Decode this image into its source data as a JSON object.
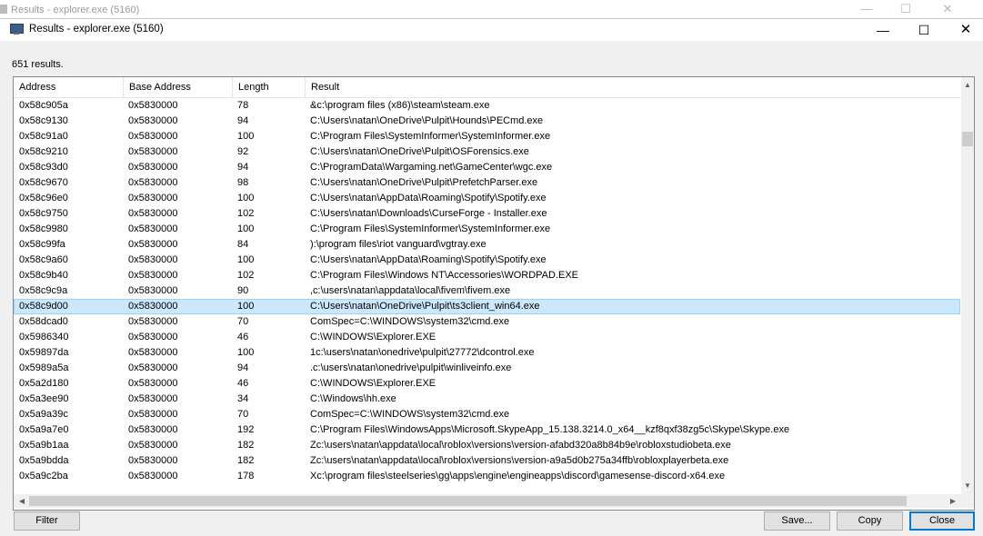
{
  "ghost_window": {
    "title": "Results - explorer.exe (5160)"
  },
  "window": {
    "title": "Results - explorer.exe (5160)",
    "controls": {
      "minimize": "—",
      "maximize": "☐",
      "close": "✕"
    }
  },
  "results_count": "651 results.",
  "columns": [
    "Address",
    "Base Address",
    "Length",
    "Result"
  ],
  "selected_index": 13,
  "rows": [
    [
      "0x58c905a",
      "0x5830000",
      "78",
      "&c:\\program files (x86)\\steam\\steam.exe"
    ],
    [
      "0x58c9130",
      "0x5830000",
      "94",
      "C:\\Users\\natan\\OneDrive\\Pulpit\\Hounds\\PECmd.exe"
    ],
    [
      "0x58c91a0",
      "0x5830000",
      "100",
      "C:\\Program Files\\SystemInformer\\SystemInformer.exe"
    ],
    [
      "0x58c9210",
      "0x5830000",
      "92",
      "C:\\Users\\natan\\OneDrive\\Pulpit\\OSForensics.exe"
    ],
    [
      "0x58c93d0",
      "0x5830000",
      "94",
      "C:\\ProgramData\\Wargaming.net\\GameCenter\\wgc.exe"
    ],
    [
      "0x58c9670",
      "0x5830000",
      "98",
      "C:\\Users\\natan\\OneDrive\\Pulpit\\PrefetchParser.exe"
    ],
    [
      "0x58c96e0",
      "0x5830000",
      "100",
      "C:\\Users\\natan\\AppData\\Roaming\\Spotify\\Spotify.exe"
    ],
    [
      "0x58c9750",
      "0x5830000",
      "102",
      "C:\\Users\\natan\\Downloads\\CurseForge - Installer.exe"
    ],
    [
      "0x58c9980",
      "0x5830000",
      "100",
      "C:\\Program Files\\SystemInformer\\SystemInformer.exe"
    ],
    [
      "0x58c99fa",
      "0x5830000",
      "84",
      "):\\program files\\riot vanguard\\vgtray.exe"
    ],
    [
      "0x58c9a60",
      "0x5830000",
      "100",
      "C:\\Users\\natan\\AppData\\Roaming\\Spotify\\Spotify.exe"
    ],
    [
      "0x58c9b40",
      "0x5830000",
      "102",
      "C:\\Program Files\\Windows NT\\Accessories\\WORDPAD.EXE"
    ],
    [
      "0x58c9c9a",
      "0x5830000",
      "90",
      ",c:\\users\\natan\\appdata\\local\\fivem\\fivem.exe"
    ],
    [
      "0x58c9d00",
      "0x5830000",
      "100",
      "C:\\Users\\natan\\OneDrive\\Pulpit\\ts3client_win64.exe"
    ],
    [
      "0x58dcad0",
      "0x5830000",
      "70",
      "ComSpec=C:\\WINDOWS\\system32\\cmd.exe"
    ],
    [
      "0x5986340",
      "0x5830000",
      "46",
      "C:\\WINDOWS\\Explorer.EXE"
    ],
    [
      "0x59897da",
      "0x5830000",
      "100",
      "1c:\\users\\natan\\onedrive\\pulpit\\27772\\dcontrol.exe"
    ],
    [
      "0x5989a5a",
      "0x5830000",
      "94",
      ".c:\\users\\natan\\onedrive\\pulpit\\winliveinfo.exe"
    ],
    [
      "0x5a2d180",
      "0x5830000",
      "46",
      "C:\\WINDOWS\\Explorer.EXE"
    ],
    [
      "0x5a3ee90",
      "0x5830000",
      "34",
      "C:\\Windows\\hh.exe"
    ],
    [
      "0x5a9a39c",
      "0x5830000",
      "70",
      "ComSpec=C:\\WINDOWS\\system32\\cmd.exe"
    ],
    [
      "0x5a9a7e0",
      "0x5830000",
      "192",
      "C:\\Program Files\\WindowsApps\\Microsoft.SkypeApp_15.138.3214.0_x64__kzf8qxf38zg5c\\Skype\\Skype.exe"
    ],
    [
      "0x5a9b1aa",
      "0x5830000",
      "182",
      "Zc:\\users\\natan\\appdata\\local\\roblox\\versions\\version-afabd320a8b84b9e\\robloxstudiobeta.exe"
    ],
    [
      "0x5a9bdda",
      "0x5830000",
      "182",
      "Zc:\\users\\natan\\appdata\\local\\roblox\\versions\\version-a9a5d0b275a34ffb\\robloxplayerbeta.exe"
    ],
    [
      "0x5a9c2ba",
      "0x5830000",
      "178",
      "Xc:\\program files\\steelseries\\gg\\apps\\engine\\engineapps\\discord\\gamesense-discord-x64.exe"
    ]
  ],
  "buttons": {
    "filter": "Filter",
    "save": "Save...",
    "copy": "Copy",
    "close": "Close"
  }
}
